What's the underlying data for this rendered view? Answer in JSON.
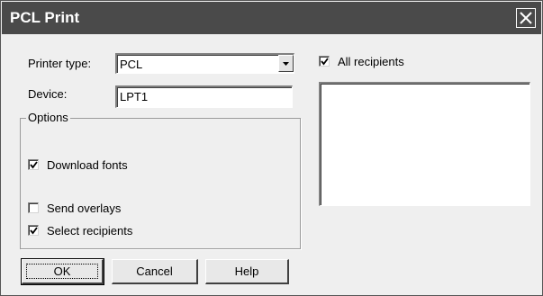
{
  "window": {
    "title": "PCL Print",
    "close_icon": "close-icon"
  },
  "form": {
    "printer_type_label": "Printer type:",
    "printer_type_value": "PCL",
    "device_label": "Device:",
    "device_value": "LPT1"
  },
  "options": {
    "legend": "Options",
    "download_fonts": {
      "label": "Download fonts",
      "checked": true
    },
    "send_overlays": {
      "label": "Send overlays",
      "checked": false
    },
    "select_recipients": {
      "label": "Select recipients",
      "checked": true
    }
  },
  "recipients": {
    "all_recipients": {
      "label": "All recipients",
      "checked": true
    },
    "list_items": []
  },
  "buttons": {
    "ok": "OK",
    "cancel": "Cancel",
    "help": "Help"
  },
  "colors": {
    "titlebar": "#4a4a4a",
    "face": "#efefef"
  }
}
